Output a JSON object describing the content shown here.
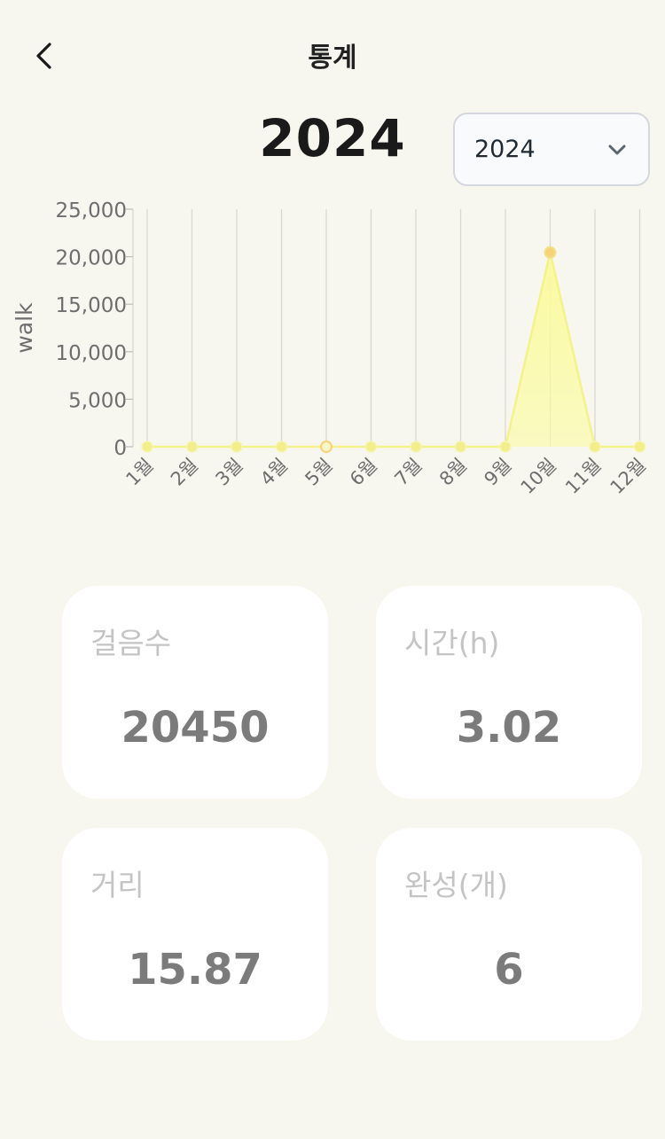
{
  "header": {
    "title": "통계"
  },
  "year_title": "2024",
  "year_select": {
    "value": "2024"
  },
  "chart_data": {
    "type": "area",
    "categories": [
      "1월",
      "2월",
      "3월",
      "4월",
      "5월",
      "6월",
      "7월",
      "8월",
      "9월",
      "10월",
      "11월",
      "12월"
    ],
    "series": [
      {
        "values": [
          0,
          0,
          0,
          0,
          0,
          0,
          0,
          0,
          0,
          20450,
          0,
          0
        ]
      }
    ],
    "ylabel": "walk",
    "ylim": [
      0,
      25000
    ],
    "yticks": [
      0,
      5000,
      10000,
      15000,
      20000,
      25000
    ],
    "ytick_labels": [
      "0",
      "5,000",
      "10,000",
      "15,000",
      "20,000",
      "25,000"
    ],
    "grid": "vertical",
    "colors": {
      "line": "#f3f38a",
      "fill": "#fbfb9c",
      "point": "#f2ee8a",
      "highlight_point": "#f6d27a"
    }
  },
  "stats": [
    {
      "label": "걸음수",
      "value": "20450"
    },
    {
      "label": "시간(h)",
      "value": "3.02"
    },
    {
      "label": "거리",
      "value": "15.87"
    },
    {
      "label": "완성(개)",
      "value": "6"
    }
  ]
}
